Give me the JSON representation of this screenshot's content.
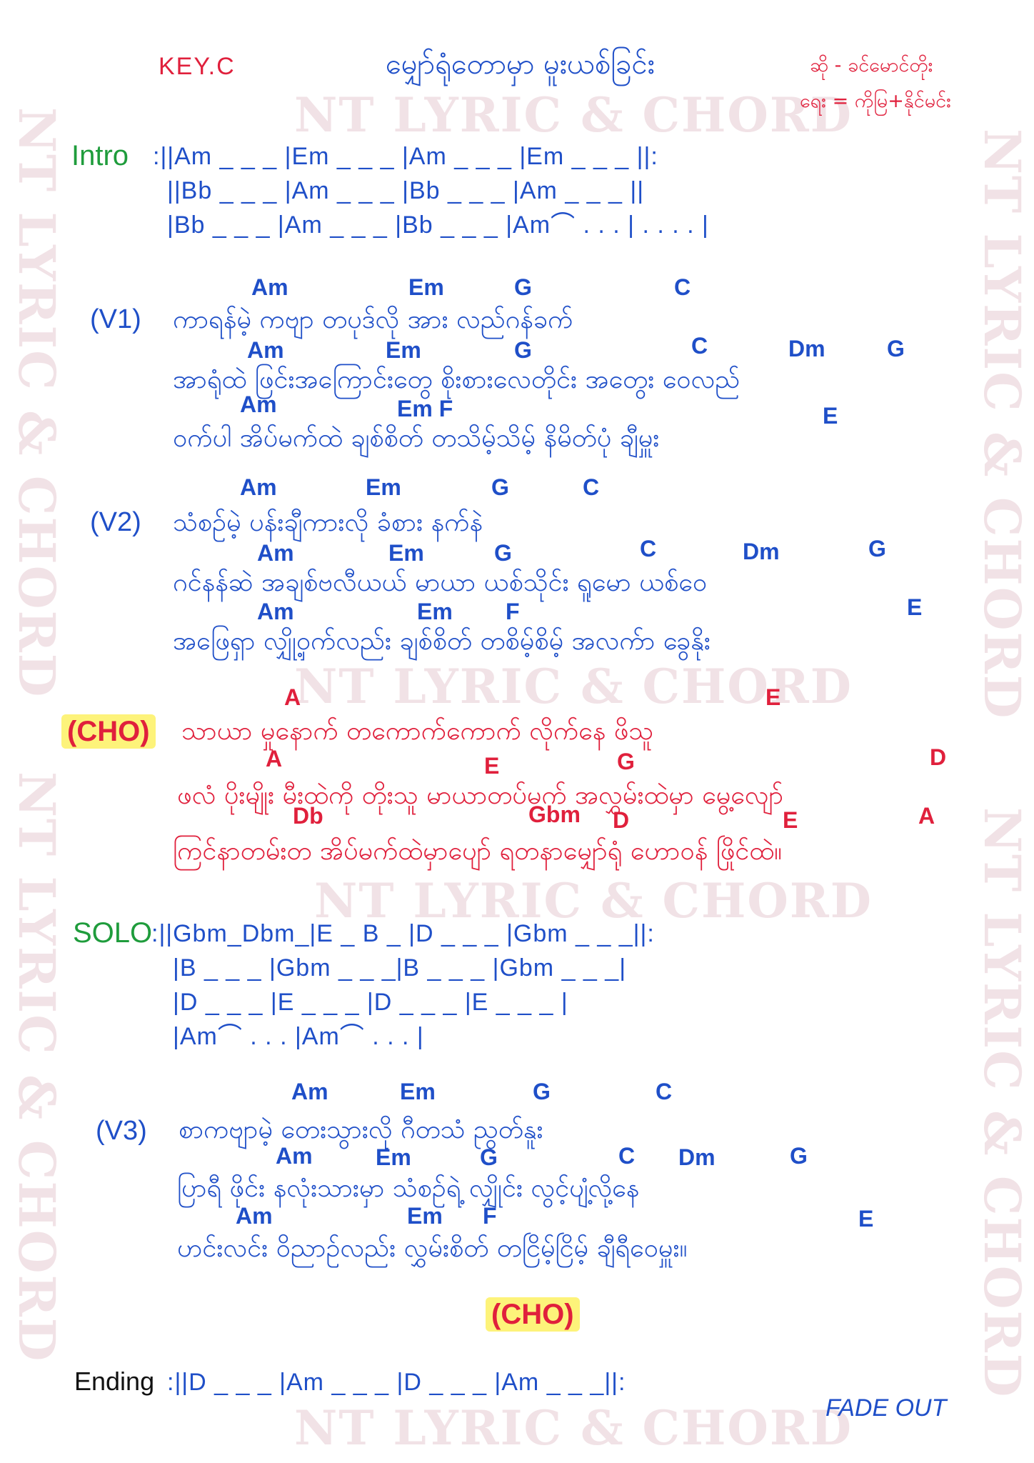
{
  "header": {
    "key": "KEY.C",
    "title": "မျှော်ရုံတောမှာ မူးယစ်ခြင်း",
    "singer": "ဆို - ခင်မောင်တိုး",
    "writer": "ရေး = ကိုမြ+နိုင်မင်း"
  },
  "watermark": "NT LYRIC & CHORD",
  "intro": {
    "label": "Intro",
    "lines": [
      ":||Am _ _ _ |Em _ _ _ |Am _ _ _ |Em _ _ _ ||:",
      "||Bb _ _ _ |Am _ _ _ |Bb _ _ _ |Am _ _ _ ||",
      "|Bb _ _ _ |Am _ _ _ |Bb _ _ _ |Am⌒ . . . | . . . . |"
    ]
  },
  "v1": {
    "label": "(V1)",
    "chords": [
      [
        "Am",
        "Em",
        "G",
        "C"
      ],
      [
        "Am",
        "Em",
        "G",
        "C",
        "Dm",
        "G"
      ],
      [
        "Am",
        "Em F",
        "E"
      ]
    ],
    "lines": [
      "ကာရန်မဲ့ ကဗျာ တပုဒ်လို အား လည်ဂန်ခက်",
      "အာရုံထဲ ဖြင်းအကြောင်းတွေ စိုးစားလေတိုင်း အတွေး ဝေလည်",
      "ဝက်ပါ အိပ်မက်ထဲ ချစ်စိတ် တသိမ့်သိမ့် နိမိတ်ပုံ ချီမှူး"
    ]
  },
  "v2": {
    "label": "(V2)",
    "chords": [
      [
        "Am",
        "Em",
        "G",
        "C"
      ],
      [
        "Am",
        "Em",
        "G",
        "C",
        "Dm",
        "G"
      ],
      [
        "Am",
        "Em",
        "F",
        "E"
      ]
    ],
    "lines": [
      "သံစဉ်မဲ့ ပန်းချီကားလို ခံစား နက်နဲ",
      "ဂင်နန်ဆဲ အချစ်ဗလီယယ် မာယာ ယစ်သိုင်း ရူမော ယစ်ဝေ",
      "အဖြေရှာ လျှို့ဝှက်လည်း ချစ်စိတ် တစိမ့်စိမ့် အလက်ာ ခွေနိုး"
    ]
  },
  "cho": {
    "label": "(CHO)",
    "chords": [
      [
        "A",
        "E"
      ],
      [
        "A",
        "E",
        "G",
        "D"
      ],
      [
        "Db",
        "Gbm",
        "D",
        "E",
        "A"
      ]
    ],
    "lines": [
      "သာယာ မှုနောက် တကောက်ကောက် လိုက်နေ ဖိသူ",
      "ဖလံ ပိုးမျိုး မီးထဲကို တိုးသူ မာယာတပ်မက် အလွှမ်းထဲမှာ မွေ့လျော်",
      "ကြင်နာတမ်းတ အိပ်မက်ထဲမှာပျော် ရတနာမျှော်ရုံ ဟောဝန် ဖြိုင်ထဲ။"
    ]
  },
  "solo": {
    "label": "SOLO",
    "lines": [
      ":||Gbm_Dbm_|E _ B _ |D _ _ _ |Gbm _ _ _||:",
      "|B _ _ _ |Gbm _ _ _|B _ _ _ |Gbm _ _ _|",
      "|D _ _ _ |E _ _ _ |D _ _ _ |E _ _ _ |",
      "|Am⌒ . . . |Am⌒ . . . |"
    ]
  },
  "v3": {
    "label": "(V3)",
    "chords": [
      [
        "Am",
        "Em",
        "G",
        "C"
      ],
      [
        "Am",
        "Em",
        "G",
        "C",
        "Dm",
        "G"
      ],
      [
        "Am",
        "Em",
        "F",
        "E"
      ]
    ],
    "lines": [
      "စာကဗျာမဲ့ တေးသွားလို ဂီတသံ ညွတ်နူး",
      "ပြာရီ ဖိုင်း နလုံးသားမှာ သံစဉ်ရဲ့ လျှိုင်း လွင့်ပျံ့လို့နေ",
      "ဟင်းလင်း ဝိညာဉ်လည်း လွှမ်းစိတ် တငြိမ့်ငြိမ့် ချီရီဝေမှူး။"
    ]
  },
  "cho_repeat": "(CHO)",
  "ending": {
    "label": "Ending",
    "line": ":||D _ _ _ |Am _ _ _ |D _ _ _ |Am _ _ _||:",
    "fade": "FADE OUT"
  }
}
